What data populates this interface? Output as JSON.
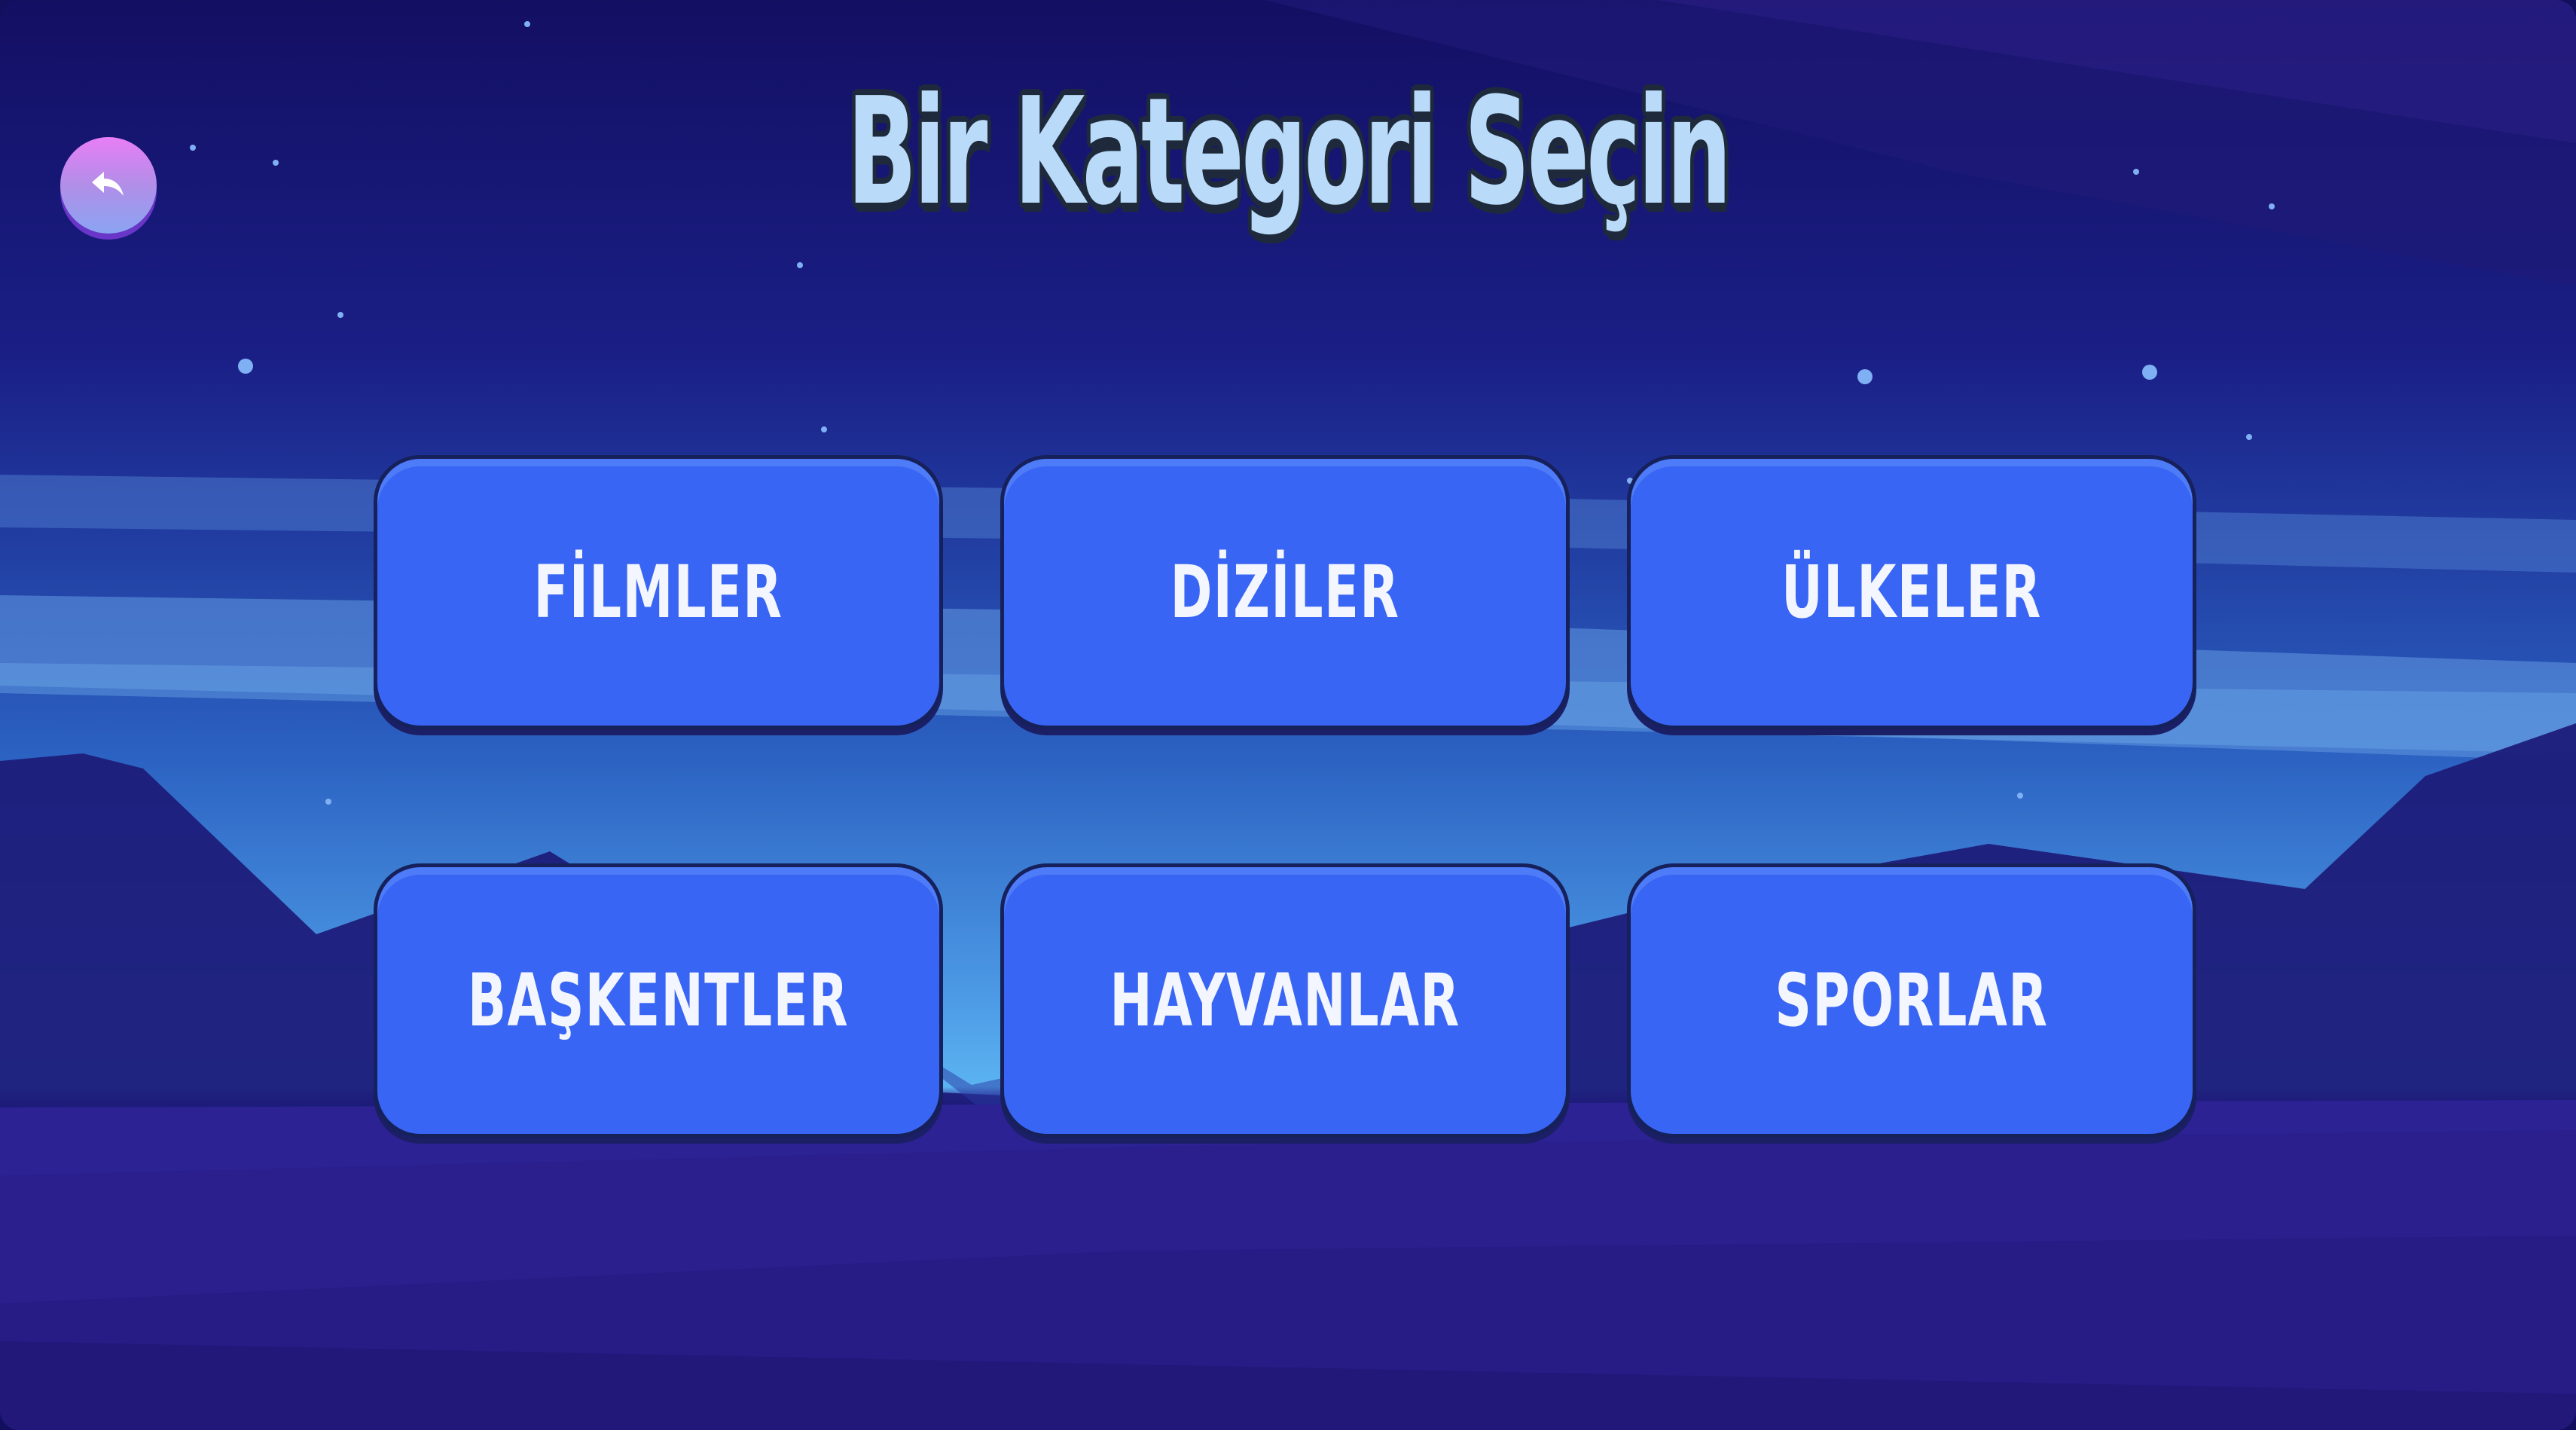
{
  "screen": {
    "title": "Bir Kategori Seçin",
    "back_icon": "back-arrow-icon"
  },
  "categories": [
    {
      "label": "FİLMLER"
    },
    {
      "label": "DİZİLER"
    },
    {
      "label": "ÜLKELER"
    },
    {
      "label": "BAŞKENTLER"
    },
    {
      "label": "HAYVANLAR"
    },
    {
      "label": "SPORLAR"
    }
  ],
  "colors": {
    "button_fill": "#3865f3",
    "button_border": "#16205a",
    "title_fill": "#b9daf8",
    "back_button_top": "#e87ef6",
    "back_button_bottom": "#8aa4f2"
  }
}
